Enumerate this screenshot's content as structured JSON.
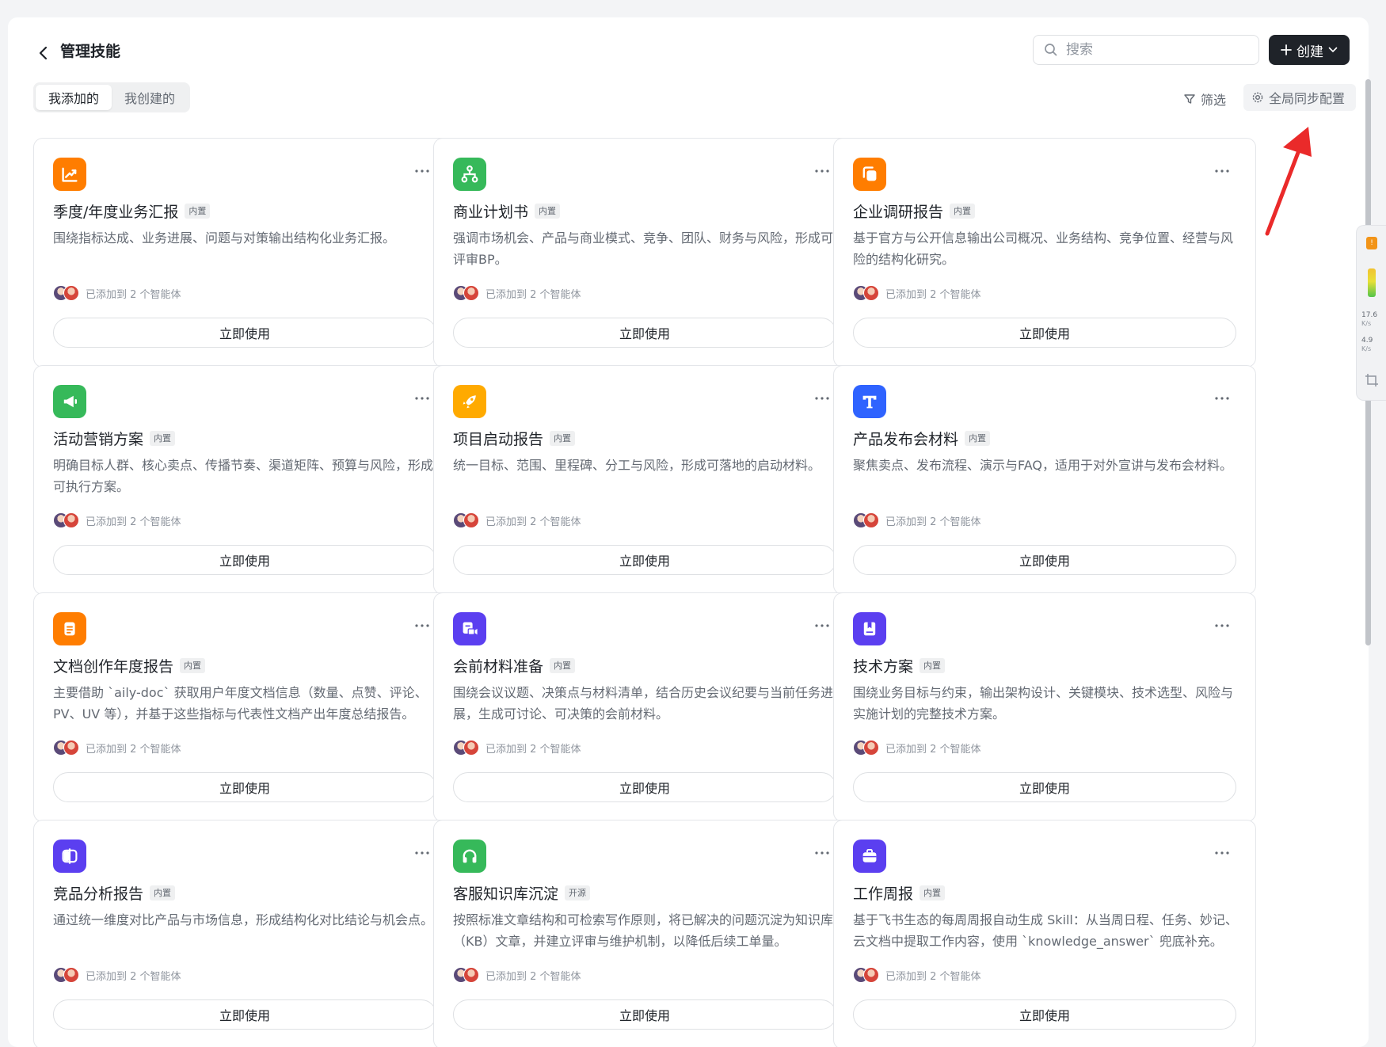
{
  "header": {
    "title": "管理技能",
    "search_placeholder": "搜索",
    "create_label": "创建"
  },
  "tabs": [
    {
      "label": "我添加的",
      "active": true
    },
    {
      "label": "我创建的",
      "active": false
    }
  ],
  "toolbar": {
    "filter_label": "筛选",
    "sync_label": "全局同步配置"
  },
  "colors": {
    "orange": "#ff7d00",
    "green": "#36b95a",
    "amber": "#ffaa00",
    "blue": "#2f63ff",
    "purple": "#5b3ff0"
  },
  "cards": [
    {
      "title": "季度/年度业务汇报",
      "tag": "内置",
      "icon": "chart-trend-icon",
      "color": "#ff7d00",
      "desc": "围绕指标达成、业务进展、问题与对策输出结构化业务汇报。",
      "meta": "已添加到 2 个智能体",
      "button": "立即使用"
    },
    {
      "title": "商业计划书",
      "tag": "内置",
      "icon": "org-chart-icon",
      "color": "#36b95a",
      "desc": "强调市场机会、产品与商业模式、竞争、团队、财务与风险，形成可评审BP。",
      "meta": "已添加到 2 个智能体",
      "button": "立即使用"
    },
    {
      "title": "企业调研报告",
      "tag": "内置",
      "icon": "copy-doc-icon",
      "color": "#ff7d00",
      "desc": "基于官方与公开信息输出公司概况、业务结构、竞争位置、经营与风险的结构化研究。",
      "meta": "已添加到 2 个智能体",
      "button": "立即使用"
    },
    {
      "title": "活动营销方案",
      "tag": "内置",
      "icon": "megaphone-icon",
      "color": "#36b95a",
      "desc": "明确目标人群、核心卖点、传播节奏、渠道矩阵、预算与风险，形成可执行方案。",
      "meta": "已添加到 2 个智能体",
      "button": "立即使用"
    },
    {
      "title": "项目启动报告",
      "tag": "内置",
      "icon": "rocket-icon",
      "color": "#ffaa00",
      "desc": "统一目标、范围、里程碑、分工与风险，形成可落地的启动材料。",
      "meta": "已添加到 2 个智能体",
      "button": "立即使用"
    },
    {
      "title": "产品发布会材料",
      "tag": "内置",
      "icon": "presentation-icon",
      "color": "#2f63ff",
      "desc": "聚焦卖点、发布流程、演示与FAQ，适用于对外宣讲与发布会材料。",
      "meta": "已添加到 2 个智能体",
      "button": "立即使用"
    },
    {
      "title": "文档创作年度报告",
      "tag": "内置",
      "icon": "document-icon",
      "color": "#ff7d00",
      "desc": "主要借助 `aily-doc` 获取用户年度文档信息（数量、点赞、评论、PV、UV 等），并基于这些指标与代表性文档产出年度总结报告。",
      "meta": "已添加到 2 个智能体",
      "button": "立即使用"
    },
    {
      "title": "会前材料准备",
      "tag": "内置",
      "icon": "video-meeting-icon",
      "color": "#5b3ff0",
      "desc": "围绕会议议题、决策点与材料清单，结合历史会议纪要与当前任务进展，生成可讨论、可决策的会前材料。",
      "meta": "已添加到 2 个智能体",
      "button": "立即使用"
    },
    {
      "title": "技术方案",
      "tag": "内置",
      "icon": "book-icon",
      "color": "#5b3ff0",
      "desc": "围绕业务目标与约束，输出架构设计、关键模块、技术选型、风险与实施计划的完整技术方案。",
      "meta": "已添加到 2 个智能体",
      "button": "立即使用"
    },
    {
      "title": "竞品分析报告",
      "tag": "内置",
      "icon": "compare-icon",
      "color": "#5b3ff0",
      "desc": "通过统一维度对比产品与市场信息，形成结构化对比结论与机会点。",
      "meta": "已添加到 2 个智能体",
      "button": "立即使用"
    },
    {
      "title": "客服知识库沉淀",
      "tag": "开源",
      "icon": "headset-icon",
      "color": "#36b95a",
      "desc": "按照标准文章结构和可检索写作原则，将已解决的问题沉淀为知识库（KB）文章，并建立评审与维护机制，以降低后续工单量。",
      "meta": "已添加到 2 个智能体",
      "button": "立即使用"
    },
    {
      "title": "工作周报",
      "tag": "内置",
      "icon": "briefcase-icon",
      "color": "#5b3ff0",
      "desc": "基于飞书生态的每周周报自动生成 Skill：从当周日程、任务、妙记、云文档中提取工作内容，使用 `knowledge_answer` 兜底补充。",
      "meta": "已添加到 2 个智能体",
      "button": "立即使用"
    }
  ],
  "side_widget": {
    "upload_speed": "17.6",
    "upload_unit": "K/s",
    "download_speed": "4.9",
    "download_unit": "K/s"
  }
}
